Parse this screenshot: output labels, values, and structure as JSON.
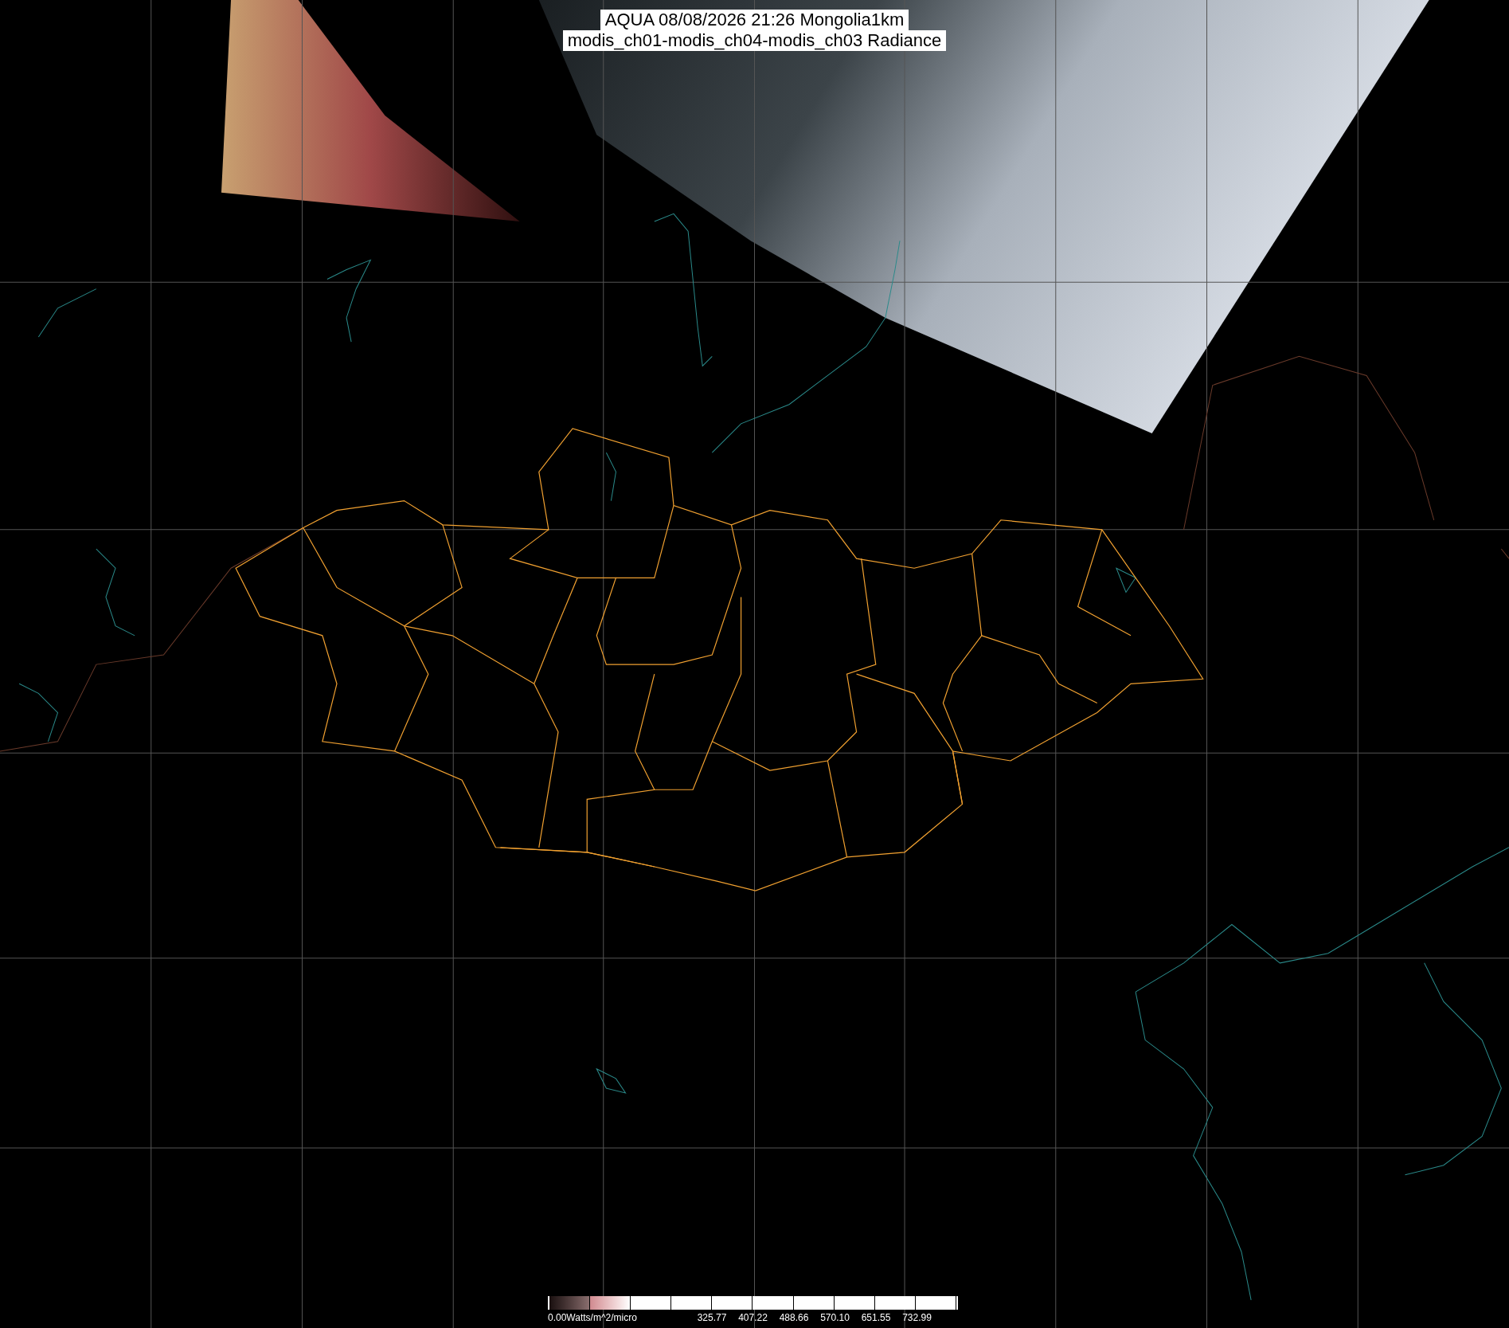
{
  "title": {
    "line_1": "AQUA 08/08/2026 21:26 Mongolia1km",
    "line_2": "modis_ch01-modis_ch04-modis_ch03 Radiance"
  },
  "colorbar": {
    "unit_label": "0.00Watts/m^2/micro",
    "tick_labels": [
      "325.77",
      "407.22",
      "488.66",
      "570.10",
      "651.55",
      "732.99"
    ]
  }
}
